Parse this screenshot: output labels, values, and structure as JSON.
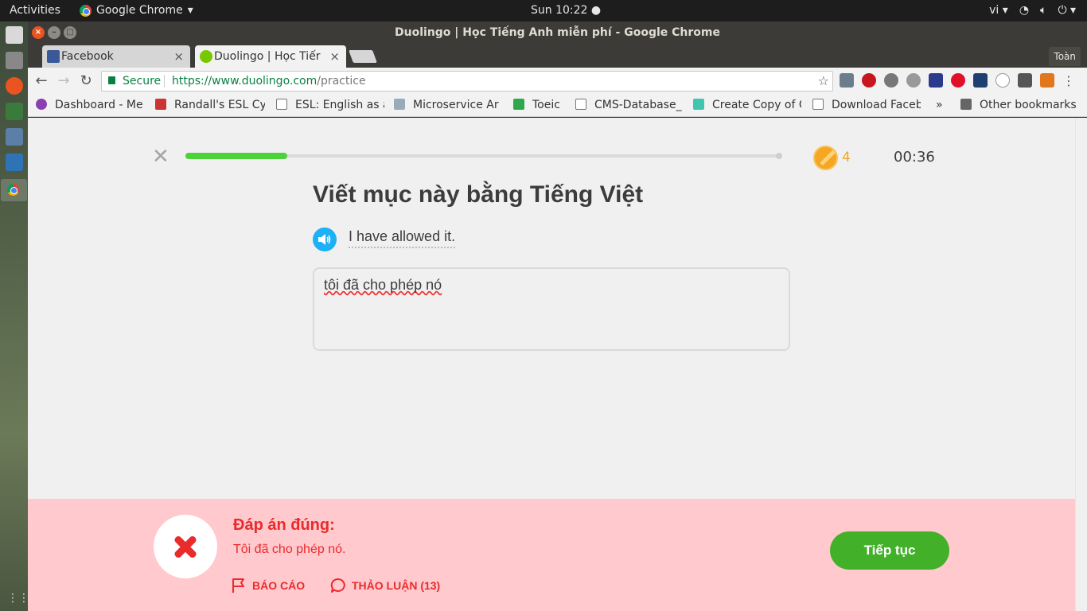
{
  "os": {
    "activities": "Activities",
    "app_menu": "Google Chrome",
    "clock": "Sun 10:22",
    "lang": "vi"
  },
  "window": {
    "title": "Duolingo | Học Tiếng Anh miễn phí - Google Chrome",
    "profile": "Toàn"
  },
  "tabs": [
    {
      "label": "Facebook",
      "close": "×"
    },
    {
      "label": "Duolingo | Học Tiếr",
      "close": "×"
    }
  ],
  "omnibox": {
    "secure": "Secure",
    "url_host": "https://www.duolingo.com",
    "url_path": "/practice"
  },
  "bookmarks": [
    {
      "label": "Dashboard - Me"
    },
    {
      "label": "Randall's ESL Cy"
    },
    {
      "label": "ESL: English as a"
    },
    {
      "label": "Microservice Ar"
    },
    {
      "label": "Toeic"
    },
    {
      "label": "CMS-Database_"
    },
    {
      "label": "Create Copy of C"
    },
    {
      "label": "Download Faceb"
    },
    {
      "label": "»"
    },
    {
      "label": "Other bookmarks"
    }
  ],
  "lesson": {
    "progress": 0.17,
    "coins": "4",
    "timer": "00:36",
    "instruction": "Viết mục này bằng Tiếng Việt",
    "prompt": "I have allowed it.",
    "answer": "tôi đã cho phép nó"
  },
  "feedback": {
    "title": "Đáp án đúng:",
    "correct_answer": "Tôi đã cho phép nó.",
    "report": "BÁO CÁO",
    "discuss": "THẢO LUẬN (13)",
    "continue": "Tiếp tục",
    "accent": "#ea2b2b",
    "background": "#ffc9ce"
  },
  "colors": {
    "progress": "#4cd23a",
    "continue": "#43b02a",
    "speaker": "#1cb0f6",
    "coin": "#f5a623"
  }
}
